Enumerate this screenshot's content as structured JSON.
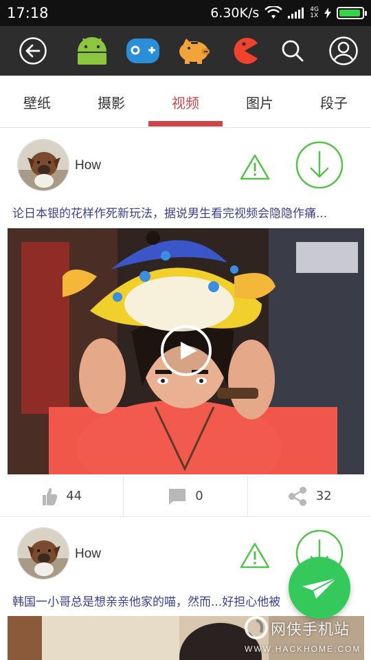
{
  "status_bar": {
    "time": "17:18",
    "net_speed": "6.30K/s",
    "network": "4G",
    "network_sub": "1X",
    "battery_level": 0.95,
    "battery_color": "#37d14a"
  },
  "toolbar": {
    "icons": [
      "back-arrow-icon",
      "android-icon",
      "gamepad-icon",
      "piggy-bank-icon",
      "pacman-icon",
      "search-icon",
      "user-profile-icon"
    ]
  },
  "tabs": [
    {
      "label": "壁纸",
      "active": false
    },
    {
      "label": "摄影",
      "active": false
    },
    {
      "label": "视频",
      "active": true
    },
    {
      "label": "图片",
      "active": false
    },
    {
      "label": "段子",
      "active": false
    }
  ],
  "accent_color": "#c8474a",
  "feed": [
    {
      "author": "How",
      "title": "论日本银的花样作死新玩法，据说男生看完视频会隐隐作痛...",
      "likes": "44",
      "comments": "0",
      "shares": "32"
    },
    {
      "author": "How",
      "title": "韩国一小哥总是想亲亲他家的喵，然而...好担心他被"
    }
  ],
  "fab": {
    "icon": "paper-plane-icon",
    "color": "#35c95b"
  },
  "watermark": {
    "cn": "网侠手机站",
    "en": "WWW.HACKHOME.COM"
  }
}
